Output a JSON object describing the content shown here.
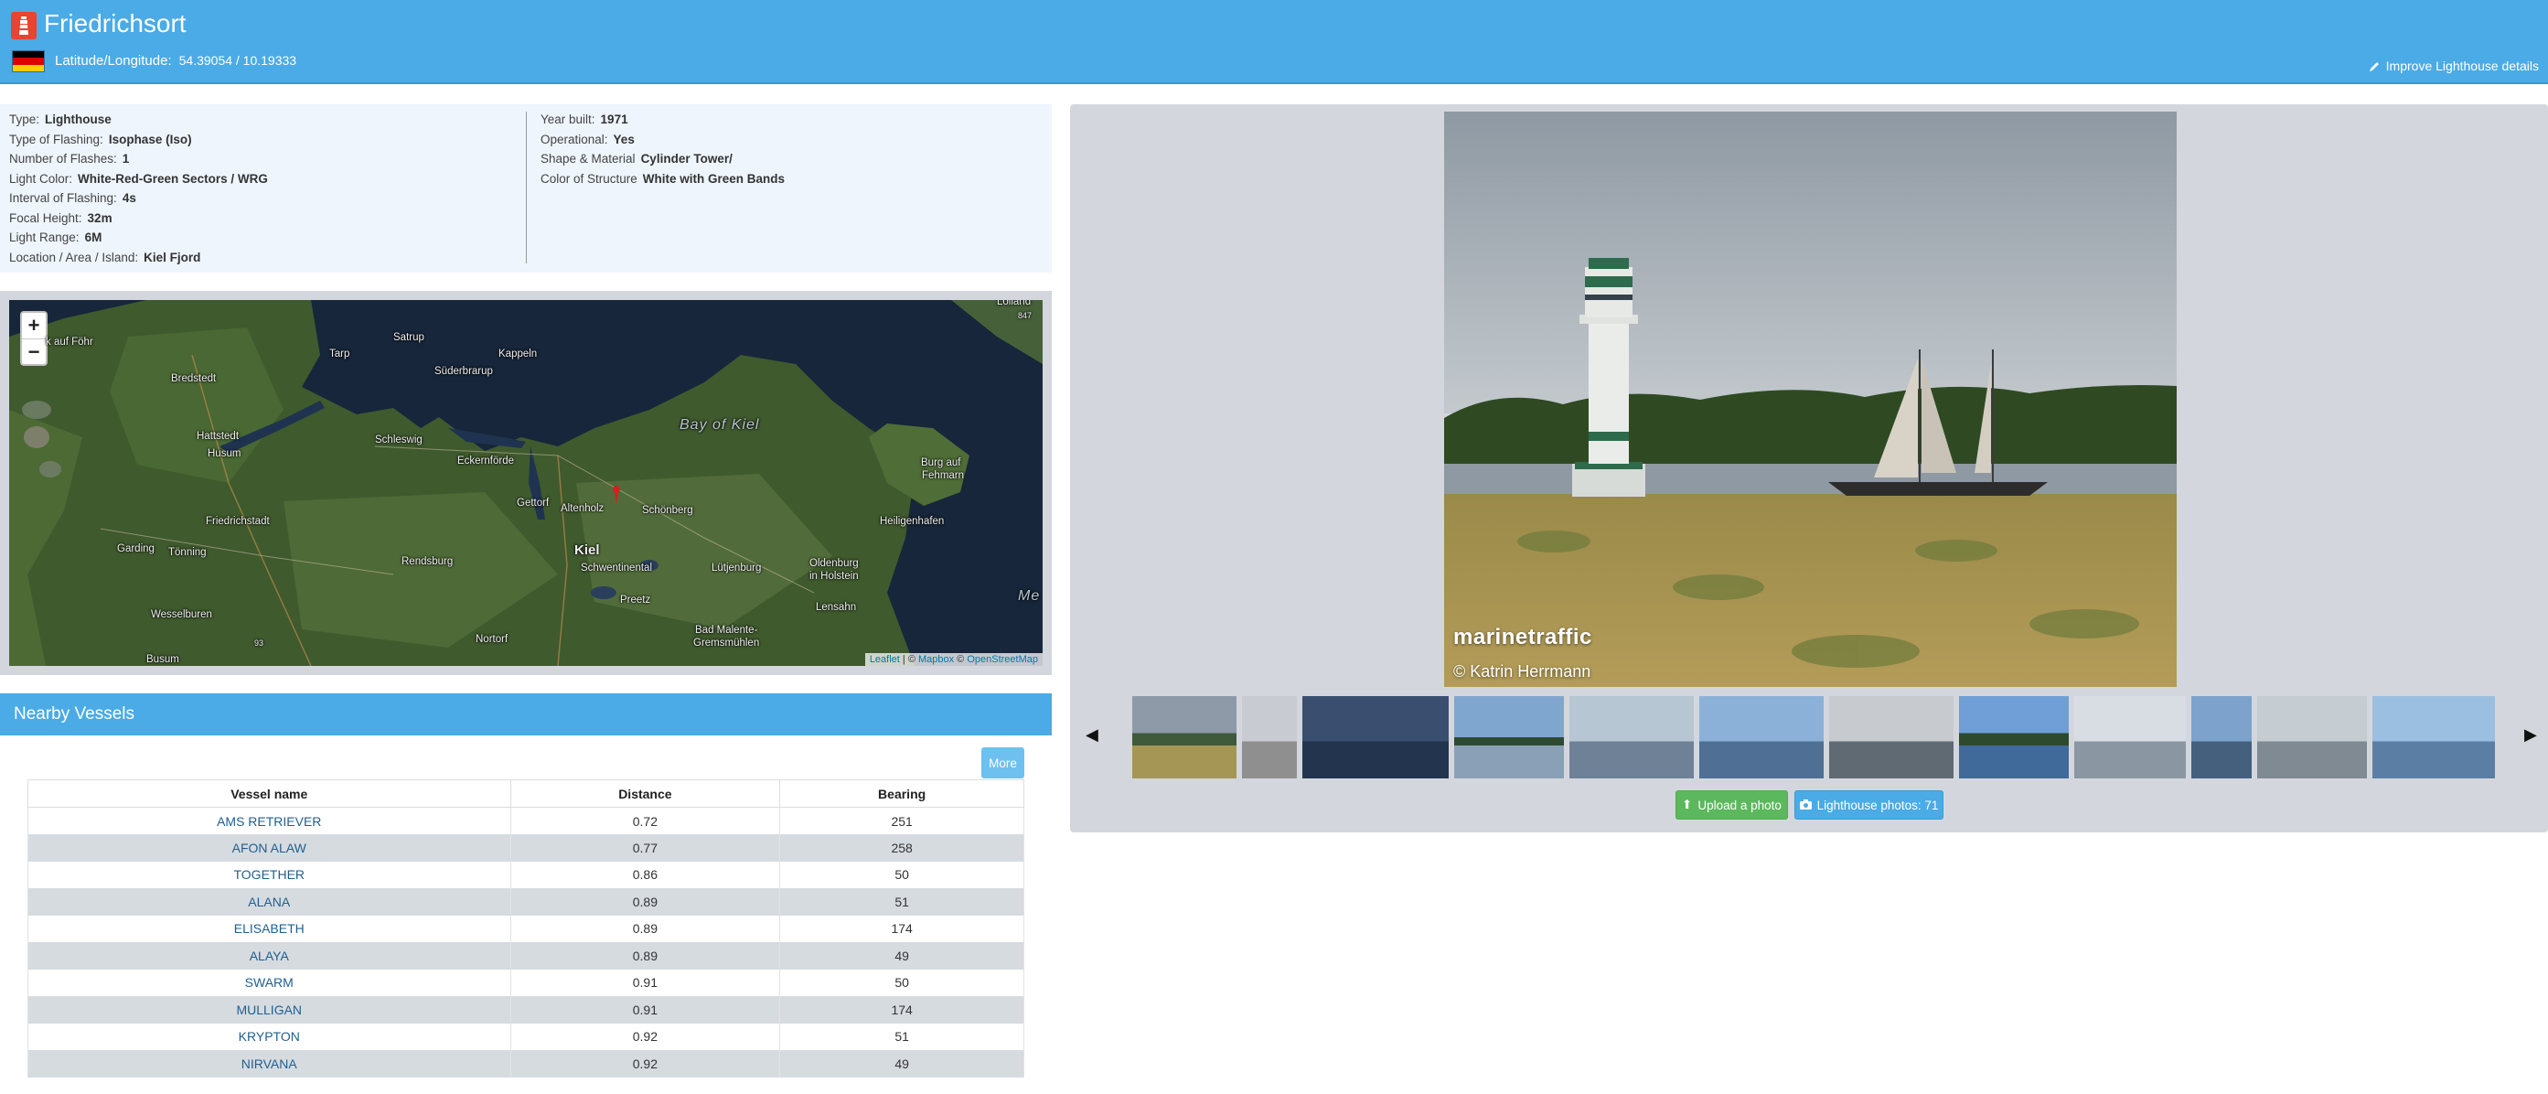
{
  "header": {
    "title": "Friedrichsort",
    "latlon_label": "Latitude/Longitude:",
    "latlon_value": "54.39054 / 10.19333",
    "improve_label": "Improve Lighthouse details",
    "flag_colors": [
      "#000000",
      "#dd0000",
      "#ffce00"
    ]
  },
  "details": {
    "left": [
      {
        "label": "Type:",
        "value": "Lighthouse"
      },
      {
        "label": "Type of Flashing:",
        "value": "Isophase (Iso)"
      },
      {
        "label": "Number of Flashes:",
        "value": "1"
      },
      {
        "label": "Light Color:",
        "value": "White-Red-Green Sectors / WRG"
      },
      {
        "label": "Interval of Flashing:",
        "value": "4s"
      },
      {
        "label": "Focal Height:",
        "value": "32m"
      },
      {
        "label": "Light Range:",
        "value": "6M"
      },
      {
        "label": "Location / Area / Island:",
        "value": "Kiel Fjord"
      }
    ],
    "right": [
      {
        "label": "Year built:",
        "value": "1971"
      },
      {
        "label": "Operational:",
        "value": "Yes"
      },
      {
        "label": "Shape & Material",
        "value": "Cylinder Tower/"
      },
      {
        "label": "Color of Structure",
        "value": "White with Green Bands"
      }
    ]
  },
  "map": {
    "zoom_in": "+",
    "zoom_out": "−",
    "labels": {
      "lolland": "Lolland",
      "num847": "847",
      "wyk": "k auf Föhr",
      "tarp": "Tarp",
      "satrup": "Satrup",
      "kappeln": "Kappeln",
      "bredstedt": "Bredstedt",
      "suderbrarup": "Süderbrarup",
      "bay": "Bay of Kiel",
      "hattstedt": "Hattstedt",
      "schleswig": "Schleswig",
      "husum": "Husum",
      "eckernforde": "Eckernförde",
      "burg": "Burg auf",
      "fehmarn": "Fehmarn",
      "gettorf": "Gettorf",
      "altenholz": "Altenholz",
      "schonberg": "Schönberg",
      "friedrichstadt": "Friedrichstadt",
      "heiligenhafen": "Heiligenhafen",
      "garding": "Garding",
      "tonning": "Tönning",
      "kiel": "Kiel",
      "rendsburg": "Rendsburg",
      "schwentinental": "Schwentinental",
      "lutjenburg": "Lütjenburg",
      "oldenburg1": "Oldenburg",
      "oldenburg2": "in Holstein",
      "preetz": "Preetz",
      "lensahn": "Lensahn",
      "me": "Me",
      "wesselburen": "Wesselburen",
      "nortorf": "Nortorf",
      "badmalente1": "Bad Malente-",
      "badmalente2": "Gremsmühlen",
      "num93": "93",
      "busum": "Busum"
    },
    "attribution": {
      "leaflet": "Leaflet",
      "sep1": " | © ",
      "mapbox": "Mapbox",
      "sep2": " © ",
      "osm": "OpenStreetMap"
    }
  },
  "nearby": {
    "title": "Nearby Vessels",
    "more_label": "More",
    "columns": [
      "Vessel name",
      "Distance",
      "Bearing"
    ],
    "rows": [
      {
        "name": "AMS RETRIEVER",
        "distance": "0.72",
        "bearing": "251"
      },
      {
        "name": "AFON ALAW",
        "distance": "0.77",
        "bearing": "258"
      },
      {
        "name": "TOGETHER",
        "distance": "0.86",
        "bearing": "50"
      },
      {
        "name": "ALANA",
        "distance": "0.89",
        "bearing": "51"
      },
      {
        "name": "ELISABETH",
        "distance": "0.89",
        "bearing": "174"
      },
      {
        "name": "ALAYA",
        "distance": "0.89",
        "bearing": "49"
      },
      {
        "name": "SWARM",
        "distance": "0.91",
        "bearing": "50"
      },
      {
        "name": "MULLIGAN",
        "distance": "0.91",
        "bearing": "174"
      },
      {
        "name": "KRYPTON",
        "distance": "0.92",
        "bearing": "51"
      },
      {
        "name": "NIRVANA",
        "distance": "0.92",
        "bearing": "49"
      }
    ]
  },
  "gallery": {
    "watermark": "marinetraffic",
    "credit": "© Katrin Herrmann",
    "upload_label": "Upload a photo",
    "photos_label": "Lighthouse photos: 71",
    "prev_icon": "caret-left-icon",
    "next_icon": "caret-right-icon"
  }
}
